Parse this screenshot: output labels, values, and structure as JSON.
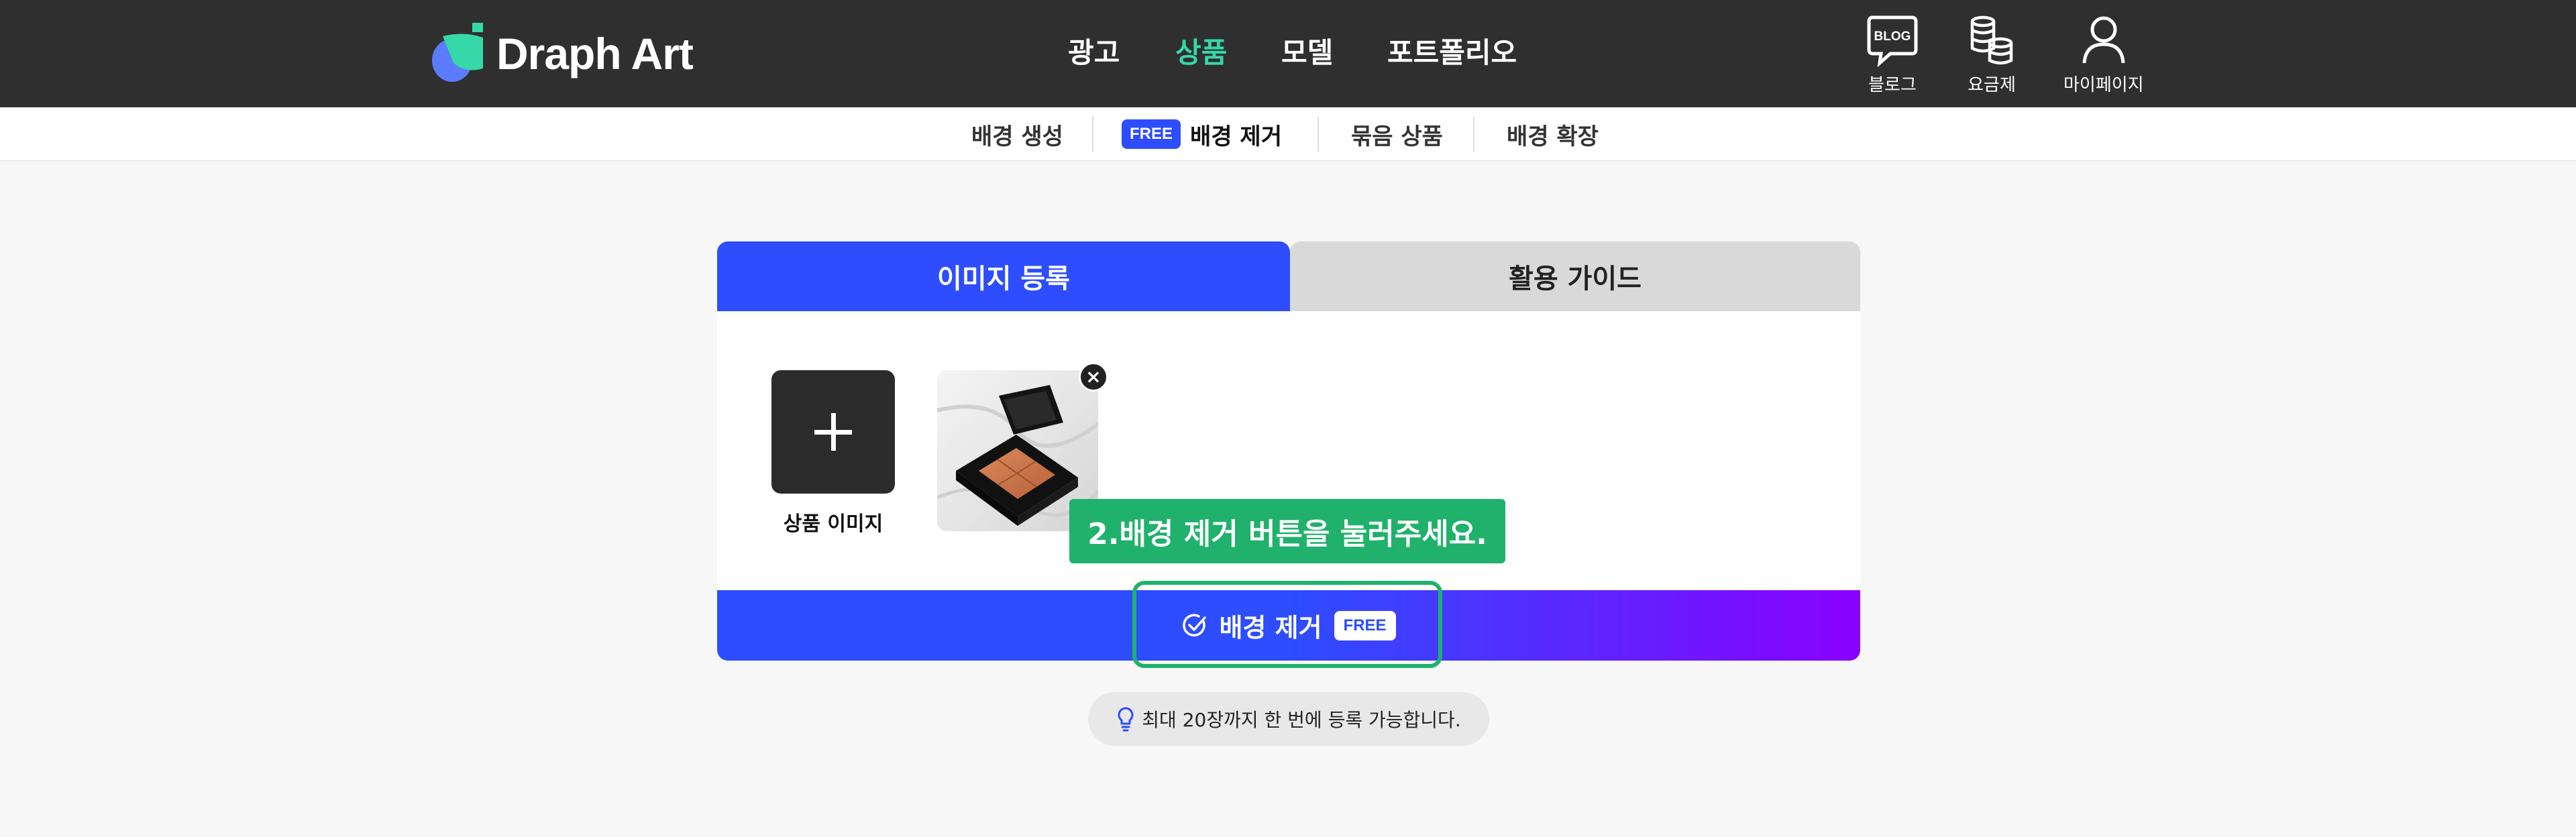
{
  "brand": {
    "name": "Draph Art"
  },
  "main_nav": [
    {
      "label": "광고",
      "active": false
    },
    {
      "label": "상품",
      "active": true
    },
    {
      "label": "모델",
      "active": false
    },
    {
      "label": "포트폴리오",
      "active": false
    }
  ],
  "utility_nav": [
    {
      "label": "블로그",
      "icon": "blog-icon",
      "icon_text": "BLOG"
    },
    {
      "label": "요금제",
      "icon": "coins-icon"
    },
    {
      "label": "마이페이지",
      "icon": "user-icon"
    }
  ],
  "sub_nav": [
    {
      "label": "배경 생성",
      "active": false
    },
    {
      "label": "배경 제거",
      "active": true,
      "badge": "FREE"
    },
    {
      "label": "묶음 상품",
      "active": false
    },
    {
      "label": "배경 확장",
      "active": false
    }
  ],
  "tabs": [
    {
      "label": "이미지 등록",
      "active": true
    },
    {
      "label": "활용 가이드",
      "active": false
    }
  ],
  "upload": {
    "add_label": "상품 이미지",
    "thumbnail": "product-photo",
    "close_symbol": "×"
  },
  "action": {
    "label": "배경 제거",
    "badge": "FREE",
    "icon": "check-circle-icon"
  },
  "guide_tooltip": "2.배경 제거 버튼을 눌러주세요.",
  "hint": {
    "icon": "lightbulb-icon",
    "text": "최대 20장까지 한 번에 등록 가능합니다."
  },
  "colors": {
    "topbar": "#2f2f2f",
    "accent_blue": "#2d4dff",
    "accent_purple": "#8a00ff",
    "nav_active": "#35d8a6",
    "guide_green": "#20b16c"
  }
}
